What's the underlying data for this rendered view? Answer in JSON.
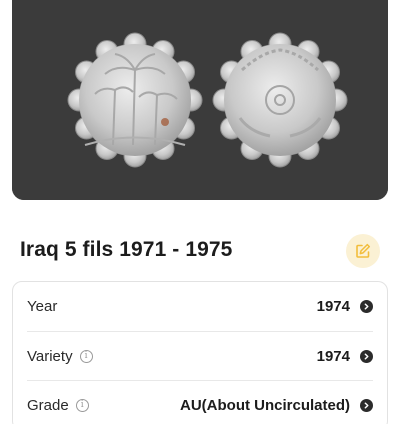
{
  "coin": {
    "title": "Iraq 5 fils 1971 - 1975",
    "image_alt": "Coin photo - obverse and reverse",
    "edit_icon": "edit-icon",
    "accent_color": "#f2bd3b"
  },
  "details": {
    "rows": [
      {
        "label": "Year",
        "value": "1974",
        "info": false
      },
      {
        "label": "Variety",
        "value": "1974",
        "info": true
      },
      {
        "label": "Grade",
        "value": "AU(About Uncirculated)",
        "info": true
      }
    ],
    "info_glyph": "i"
  }
}
